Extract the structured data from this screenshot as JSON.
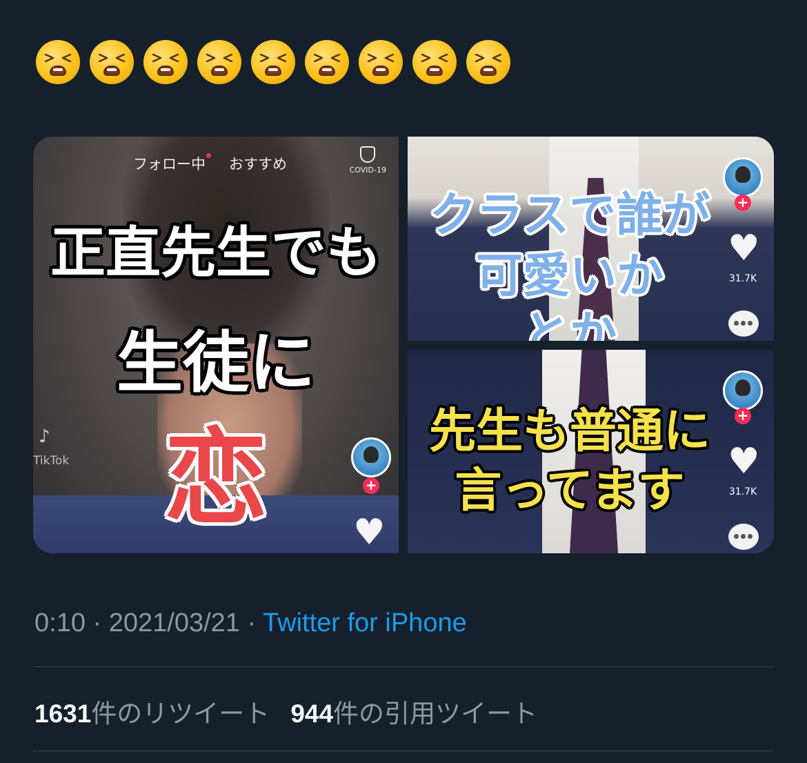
{
  "emoji_row": {
    "icon": "tired-face-emoji",
    "count": 9
  },
  "media": {
    "main": {
      "tabs": [
        "フォロー中",
        "おすすめ"
      ],
      "covid_label": "COVID-19",
      "watermark_logo": "♪",
      "watermark_text": "TikTok",
      "caption_lines": [
        "正直先生でも",
        "生徒に"
      ],
      "caption_highlight": "恋"
    },
    "top_right": {
      "caption_lines": [
        "クラスで誰が",
        "可愛いか",
        "とか"
      ],
      "like_count": "31.7K"
    },
    "bottom_right": {
      "caption_lines": [
        "先生も普通に",
        "言ってます"
      ],
      "like_count": "31.7K"
    }
  },
  "tweet_meta": {
    "time": "0:10",
    "sep1": " · ",
    "date": "2021/03/21",
    "sep2": " · ",
    "source": "Twitter for iPhone"
  },
  "stats": {
    "retweets_count": "1631",
    "retweets_label": "件のリツイート",
    "quotes_count": "944",
    "quotes_label": "件の引用ツイート"
  },
  "colors": {
    "background": "#15202b",
    "link": "#1d9bf0",
    "muted_text": "#8b98a5",
    "divider": "#38444d"
  }
}
